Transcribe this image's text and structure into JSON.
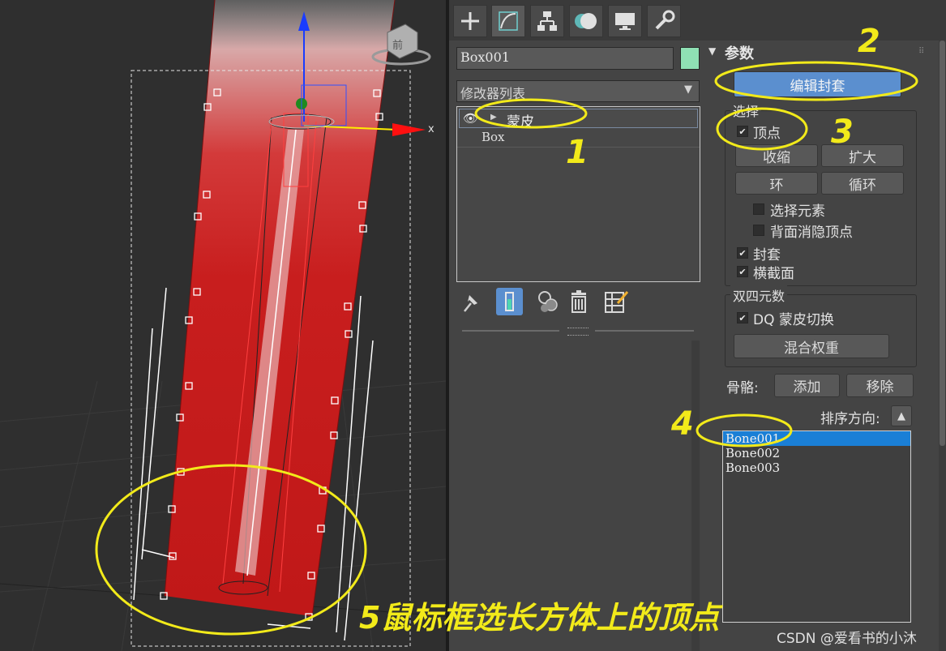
{
  "viewport": {
    "axis_label": "x",
    "nav_cube_label": "前"
  },
  "panel": {
    "tabs": [
      {
        "name": "create",
        "icon": "plus-icon"
      },
      {
        "name": "modify",
        "icon": "modify-curve-icon",
        "active": true
      },
      {
        "name": "hierarchy",
        "icon": "hierarchy-icon"
      },
      {
        "name": "motion",
        "icon": "motion-icon"
      },
      {
        "name": "display",
        "icon": "display-monitor-icon"
      },
      {
        "name": "utilities",
        "icon": "wrench-icon"
      }
    ],
    "object_name": "Box001",
    "object_color": "#8fe0b4",
    "modifier_list_label": "修改器列表",
    "stack": [
      {
        "label": "蒙皮",
        "selected": true
      },
      {
        "label": "Box",
        "selected": false
      }
    ],
    "stack_tools": [
      "pin-stack-icon",
      "show-end-result-icon",
      "make-unique-icon",
      "remove-modifier-icon",
      "configure-sets-icon"
    ]
  },
  "params": {
    "rollout_title": "参数",
    "edit_envelopes_label": "编辑封套",
    "select_group": {
      "title": "选择",
      "vertices_label": "顶点",
      "vertices_checked": true,
      "shrink_label": "收缩",
      "grow_label": "扩大",
      "ring_label": "环",
      "loop_label": "循环",
      "select_element_label": "选择元素",
      "select_element_checked": false,
      "backface_label": "背面消隐顶点",
      "backface_checked": false,
      "envelopes_label": "封套",
      "envelopes_checked": true,
      "cross_sections_label": "横截面",
      "cross_sections_checked": true
    },
    "dq_group": {
      "title": "双四元数",
      "dq_toggle_label": "DQ 蒙皮切换",
      "dq_checked": true,
      "blend_weights_label": "混合权重"
    },
    "bones_label": "骨骼:",
    "add_label": "添加",
    "remove_label": "移除",
    "sort_label": "排序方向:",
    "bones": [
      {
        "name": "Bone001",
        "selected": true
      },
      {
        "name": "Bone002",
        "selected": false
      },
      {
        "name": "Bone003",
        "selected": false
      }
    ]
  },
  "annotations": {
    "step1": "1",
    "step2": "2",
    "step3": "3",
    "step4": "4",
    "caption": "5鼠标框选长方体上的顶点",
    "highlight_color": "#f2ea1a"
  },
  "watermark": "CSDN @爱看书的小沐"
}
